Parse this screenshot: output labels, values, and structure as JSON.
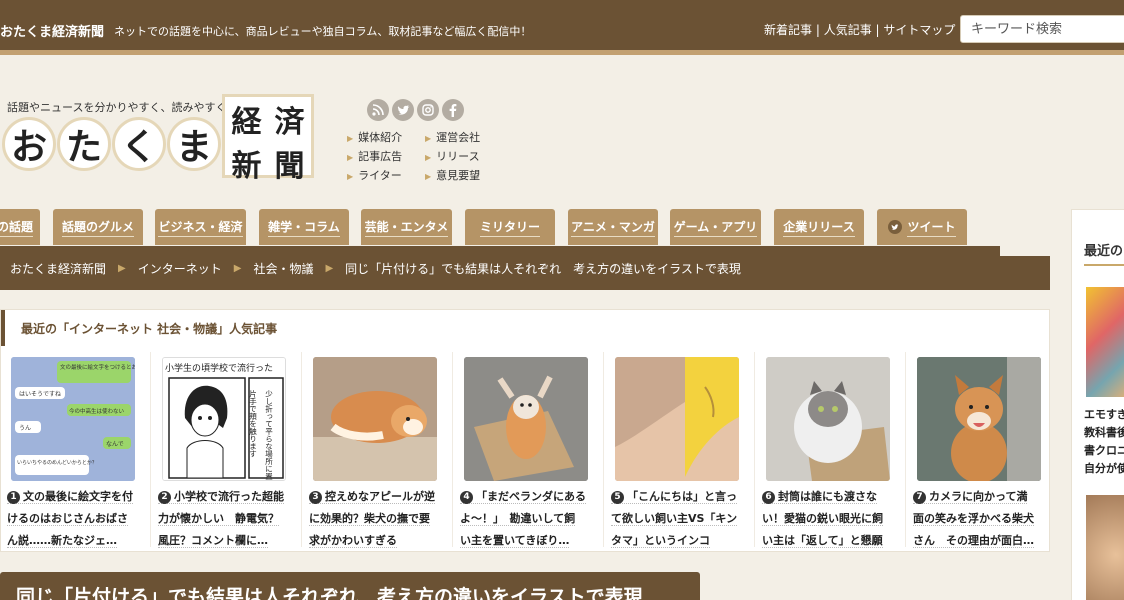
{
  "topbar": {
    "site_name": "おたくま経済新聞",
    "tagline": "ネットでの話題を中心に、商品レビューや独自コラム、取材記事など幅広く配信中！",
    "links": [
      "新着記事",
      "人気記事",
      "サイトマップ"
    ],
    "search_placeholder": "キーワード検索"
  },
  "header": {
    "logo_tagline": "話題やニュースを分かりやすく、読みやすく。",
    "logo_kana": [
      "お",
      "た",
      "く",
      "ま"
    ],
    "logo_kanji": [
      "経",
      "済",
      "新",
      "聞"
    ],
    "social_icons": [
      "rss-icon",
      "twitter-icon",
      "instagram-icon",
      "facebook-icon"
    ],
    "mini_links": [
      "媒体紹介",
      "運営会社",
      "記事広告",
      "リリース",
      "ライター",
      "意見要望"
    ]
  },
  "nav": {
    "tabs": [
      "の話題",
      "話題のグルメ",
      "ビジネス・経済",
      "雑学・コラム",
      "芸能・エンタメ",
      "ミリタリー",
      "アニメ・マンガ",
      "ゲーム・アプリ",
      "企業リリース",
      "ツイート"
    ]
  },
  "breadcrumb": [
    "おたくま経済新聞",
    "インターネット",
    "社会・物議",
    "同じ「片付ける」でも結果は人それぞれ　考え方の違いをイラストで表現"
  ],
  "popular": {
    "heading": "最近の「インターネット 社会・物議」人気記事",
    "items": [
      {
        "rank": "1",
        "lines": [
          "文の最後に絵文字を付",
          "けるのはおじさんおばさ",
          "ん説……新たなジェ…"
        ]
      },
      {
        "rank": "2",
        "lines": [
          "小学校で流行った超能",
          "力が懐かしい　静電気？",
          "風圧？コメント欄に…"
        ]
      },
      {
        "rank": "3",
        "lines": [
          "控えめなアピールが逆",
          "に効果的？柴犬の撫で要",
          "求がかわいすぎる"
        ]
      },
      {
        "rank": "4",
        "lines": [
          "「まだベランダにある",
          "よ〜！」　勘違いして飼",
          "い主を置いてきぼり…"
        ]
      },
      {
        "rank": "5",
        "lines": [
          "「こんにちは」と言っ",
          "て欲しい飼い主VS「キン",
          "タマ」というインコ"
        ]
      },
      {
        "rank": "6",
        "lines": [
          "封筒は誰にも渡さな",
          "い！愛猫の鋭い眼光に飼",
          "い主は「返して」と懇願"
        ]
      },
      {
        "rank": "7",
        "lines": [
          "カメラに向かって満",
          "面の笑みを浮かべる柴犬",
          "さん　その理由が面白…"
        ]
      }
    ]
  },
  "thumb_texts": {
    "chat_1": "文の最後に絵文字をつけるとおじさんおばさん説…",
    "chat_2": "はいそうですね",
    "chat_3": "今の中高生は使わない",
    "chat_4": "うん",
    "chat_5": "なんで",
    "chat_6": "いらいちやるのめんどいからとか？",
    "manga_caption": "小学生の頃学校で流行った",
    "manga_lines": [
      "片手で頬を触ります",
      "少し折って平らな場所に置きます"
    ]
  },
  "article": {
    "title": "同じ「片付ける」でも結果は人それぞれ　考え方の違いをイラストで表現"
  },
  "sidebar": {
    "heading": "最近の",
    "text_lines": [
      "エモすぎ",
      "教科書後",
      "書クロニ",
      "自分が使"
    ]
  },
  "colors": {
    "brown_dark": "#6b5234",
    "tab_brown": "#b59466",
    "gold_accent": "#c9a86a",
    "background": "#f3efe6"
  }
}
